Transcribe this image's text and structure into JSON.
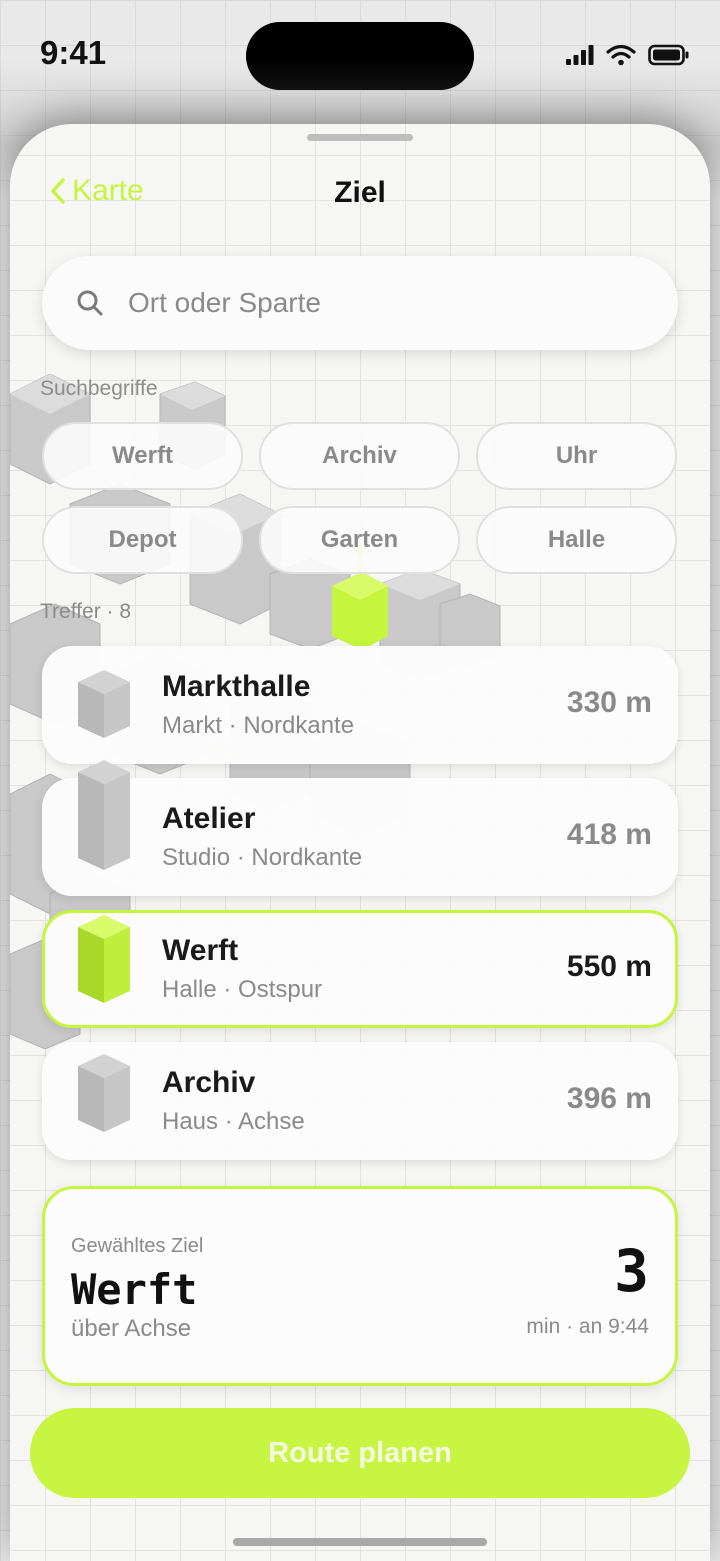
{
  "status_bar": {
    "time": "9:41",
    "icons": [
      "cellular-icon",
      "wifi-icon",
      "battery-icon"
    ]
  },
  "nav": {
    "back_label": "Karte",
    "title": "Ziel"
  },
  "search": {
    "placeholder": "Ort oder Sparte",
    "value": ""
  },
  "suggestions": {
    "label": "Suchbegriffe",
    "chips": [
      "Werft",
      "Archiv",
      "Uhr",
      "Depot",
      "Garten",
      "Halle"
    ]
  },
  "results": {
    "label": "Treffer · 8",
    "items": [
      {
        "name": "Markthalle",
        "subtitle": "Markt · Nordkante",
        "distance": "330 m",
        "selected": false
      },
      {
        "name": "Atelier",
        "subtitle": "Studio · Nordkante",
        "distance": "418 m",
        "selected": false
      },
      {
        "name": "Werft",
        "subtitle": "Halle · Ostspur",
        "distance": "550 m",
        "selected": true
      },
      {
        "name": "Archiv",
        "subtitle": "Haus · Achse",
        "distance": "396 m",
        "selected": false
      }
    ]
  },
  "selected_target": {
    "label": "Gewähltes Ziel",
    "name": "Werft",
    "via": "über Achse",
    "minutes": "3",
    "eta": "min · an 9:44"
  },
  "route_button": {
    "label": "Route planen"
  },
  "colors": {
    "accent": "#c6f53d",
    "text": "#1a1a1a",
    "muted": "#8a8a8a",
    "sheet": "#f6f6f4"
  }
}
